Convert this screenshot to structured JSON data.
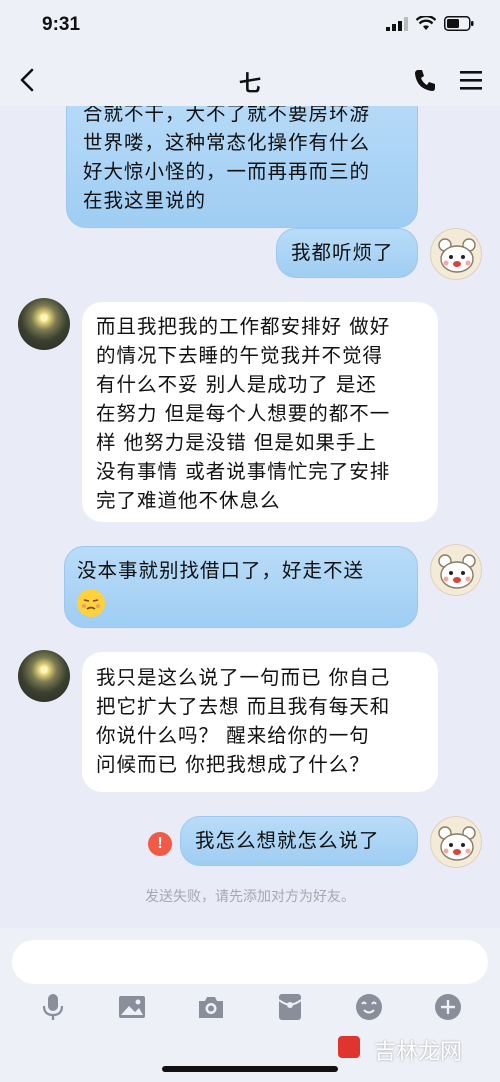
{
  "status": {
    "time": "9:31"
  },
  "header": {
    "title": "七"
  },
  "messages": [
    {
      "side": "mine",
      "lines": [
        "合就不干，大不了就不要房环游",
        "世界喽，这种常态化操作有什么",
        "好大惊小怪的，一而再再而三的",
        "在我这里说的"
      ]
    },
    {
      "side": "mine",
      "lines": [
        "我都听烦了"
      ]
    },
    {
      "side": "theirs",
      "lines": [
        "而且我把我的工作都安排好 做好",
        "的情况下去睡的午觉我并不觉得",
        "有什么不妥  别人是成功了 是还",
        "在努力 但是每个人想要的都不一",
        "样 他努力是没错  但是如果手上",
        "没有事情 或者说事情忙完了安排",
        "完了难道他不休息么"
      ]
    },
    {
      "side": "mine",
      "lines": [
        "没本事就别找借口了，好走不送"
      ]
    },
    {
      "side": "theirs",
      "lines": [
        "我只是这么说了一句而已 你自己",
        "把它扩大了去想 而且我有每天和",
        "你说什么吗？  醒来给你的一句",
        "问候而已  你把我想成了什么？"
      ]
    },
    {
      "side": "mine",
      "lines": [
        "我怎么想就怎么说了"
      ]
    }
  ],
  "fail_notice": "发送失败，请先添加对方为好友。",
  "fail_icon": "!",
  "watermark": "吉林龙网",
  "icons": [
    "back-icon",
    "phone-icon",
    "menu-icon",
    "microphone-icon",
    "image-icon",
    "camera-icon",
    "red-packet-icon",
    "emoji-icon",
    "plus-icon"
  ],
  "colors": {
    "mine_bubble": "#a9d3f5",
    "background": "#e9ecf6",
    "fail": "#f05a46"
  }
}
